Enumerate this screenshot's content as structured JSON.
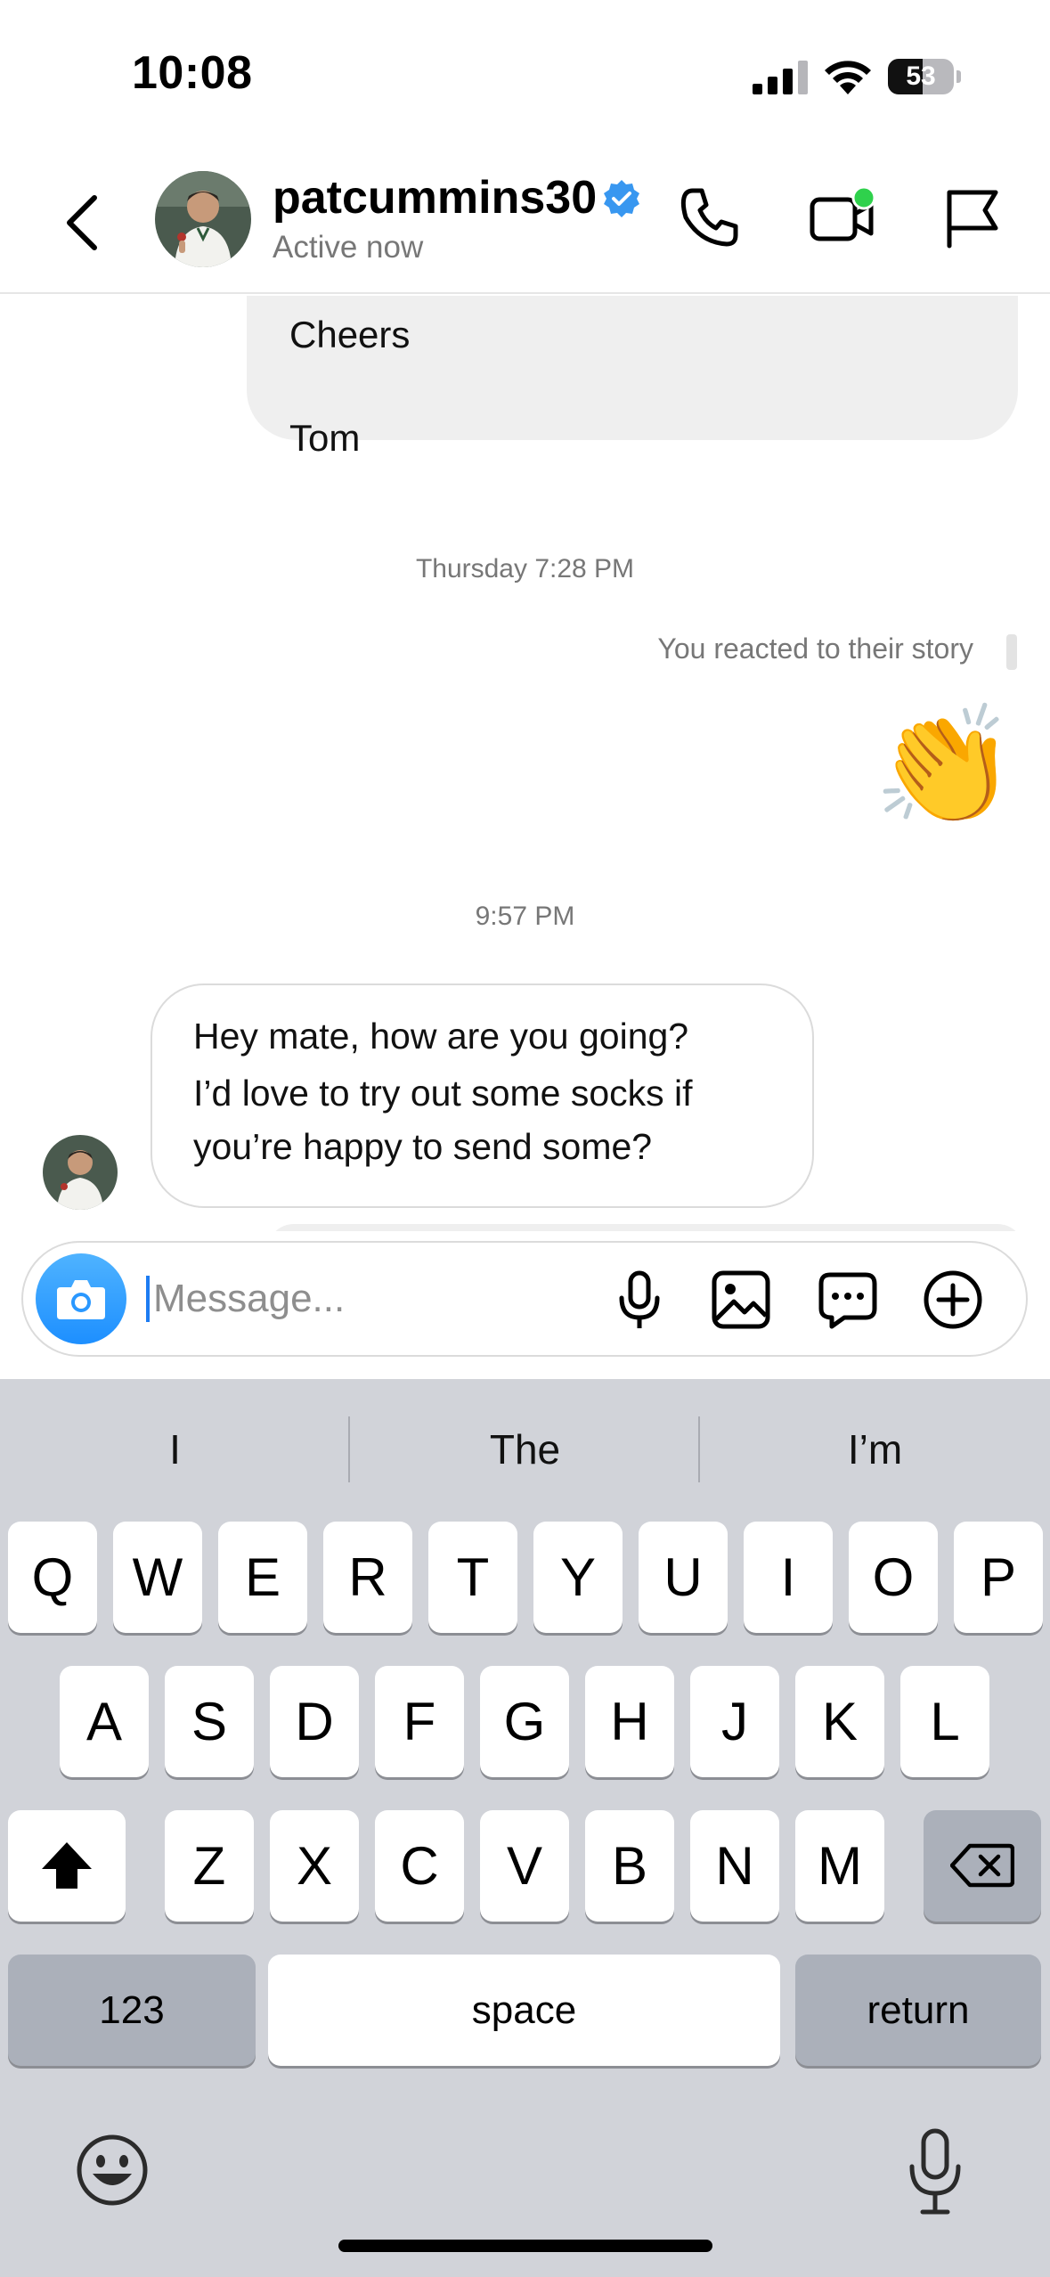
{
  "status_bar": {
    "time": "10:08",
    "battery_level": "53",
    "battery_fraction": 0.53
  },
  "header": {
    "username": "patcummins30",
    "presence": "Active now",
    "verified": true,
    "icons": [
      "back-chevron-icon",
      "phone-icon",
      "video-call-icon",
      "flag-icon"
    ],
    "video_status_color": "#2fd14c"
  },
  "messages": {
    "outgoing_text_lines": [
      "Cheers",
      "Tom"
    ],
    "timestamp_1": "Thursday 7:28 PM",
    "story_reaction_note": "You reacted to their story",
    "story_reaction_emoji": "👏",
    "timestamp_2": "9:57 PM",
    "incoming_text_lines": [
      "Hey mate, how are you going?",
      "I’d love to try out some socks if",
      "you’re happy to send some?"
    ]
  },
  "composer": {
    "placeholder": "Message...",
    "value": "",
    "icons": [
      "camera-icon",
      "microphone-icon",
      "gallery-icon",
      "sticker-chat-icon",
      "add-icon"
    ],
    "camera_color": "#1d8fff"
  },
  "keyboard": {
    "suggestions": [
      "I",
      "The",
      "I’m"
    ],
    "row1": [
      "Q",
      "W",
      "E",
      "R",
      "T",
      "Y",
      "U",
      "I",
      "O",
      "P"
    ],
    "row2": [
      "A",
      "S",
      "D",
      "F",
      "G",
      "H",
      "J",
      "K",
      "L"
    ],
    "row3": [
      "Z",
      "X",
      "C",
      "V",
      "B",
      "N",
      "M"
    ],
    "numbers_label": "123",
    "space_label": "space",
    "return_label": "return"
  }
}
